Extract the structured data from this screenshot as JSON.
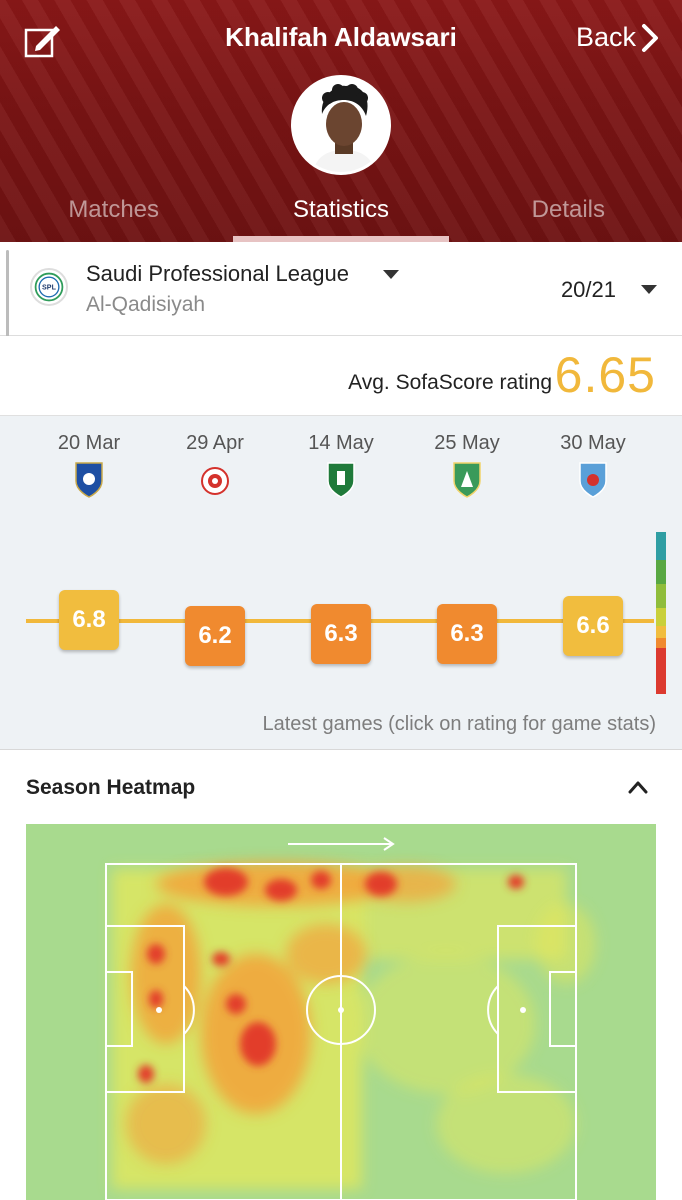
{
  "header": {
    "title": "Khalifah Aldawsari",
    "back_label": "Back"
  },
  "tabs": [
    {
      "label": "Matches",
      "active": false
    },
    {
      "label": "Statistics",
      "active": true
    },
    {
      "label": "Details",
      "active": false
    }
  ],
  "league": {
    "logo_text": "SPL",
    "name": "Saudi Professional League",
    "team": "Al-Qadisiyah",
    "season": "20/21"
  },
  "rating": {
    "label": "Avg. SofaScore rating",
    "value": "6.65"
  },
  "games": [
    {
      "date": "20 Mar",
      "rating": "6.8",
      "color": "#f1bd3e",
      "crest_color": "#1e4fa3"
    },
    {
      "date": "29 Apr",
      "rating": "6.2",
      "color": "#f08a2f",
      "crest_color": "#d4322c"
    },
    {
      "date": "14 May",
      "rating": "6.3",
      "color": "#f08a2f",
      "crest_color": "#1f7a3a"
    },
    {
      "date": "25 May",
      "rating": "6.3",
      "color": "#f08a2f",
      "crest_color": "#3a9a5a"
    },
    {
      "date": "30 May",
      "rating": "6.6",
      "color": "#f1bd3e",
      "crest_color": "#5aa0d8"
    }
  ],
  "games_caption": "Latest games (click on rating for game stats)",
  "scale_colors": [
    "#2f9ea3",
    "#58a842",
    "#8fbd3b",
    "#c9d03a",
    "#f1bd3e",
    "#f08a2f",
    "#dc3a2f"
  ],
  "heatmap": {
    "title": "Season Heatmap",
    "pitch_color": "#a8da8e"
  }
}
